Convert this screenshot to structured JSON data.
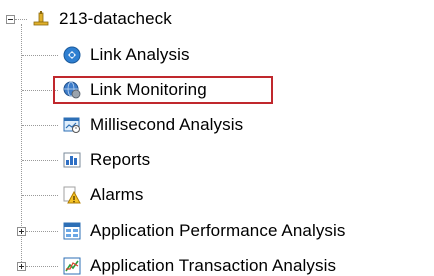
{
  "tree": {
    "root": {
      "label": "213-datacheck",
      "icon": "network-node-icon",
      "expanded": true
    },
    "items": [
      {
        "label": "Link Analysis",
        "icon": "link-analysis-icon",
        "expander": "none"
      },
      {
        "label": "Link Monitoring",
        "icon": "link-monitoring-icon",
        "expander": "none",
        "selected": true
      },
      {
        "label": "Millisecond Analysis",
        "icon": "millisecond-analysis-icon",
        "expander": "none"
      },
      {
        "label": "Reports",
        "icon": "reports-icon",
        "expander": "none"
      },
      {
        "label": "Alarms",
        "icon": "alarm-warning-icon",
        "expander": "none"
      },
      {
        "label": "Application Performance Analysis",
        "icon": "application-performance-icon",
        "expander": "collapsed"
      },
      {
        "label": "Application Transaction Analysis",
        "icon": "application-transaction-icon",
        "expander": "collapsed"
      }
    ]
  },
  "colors": {
    "highlight_border": "#c0282d",
    "tree_lines": "#9a9a9a",
    "text": "#000000"
  }
}
